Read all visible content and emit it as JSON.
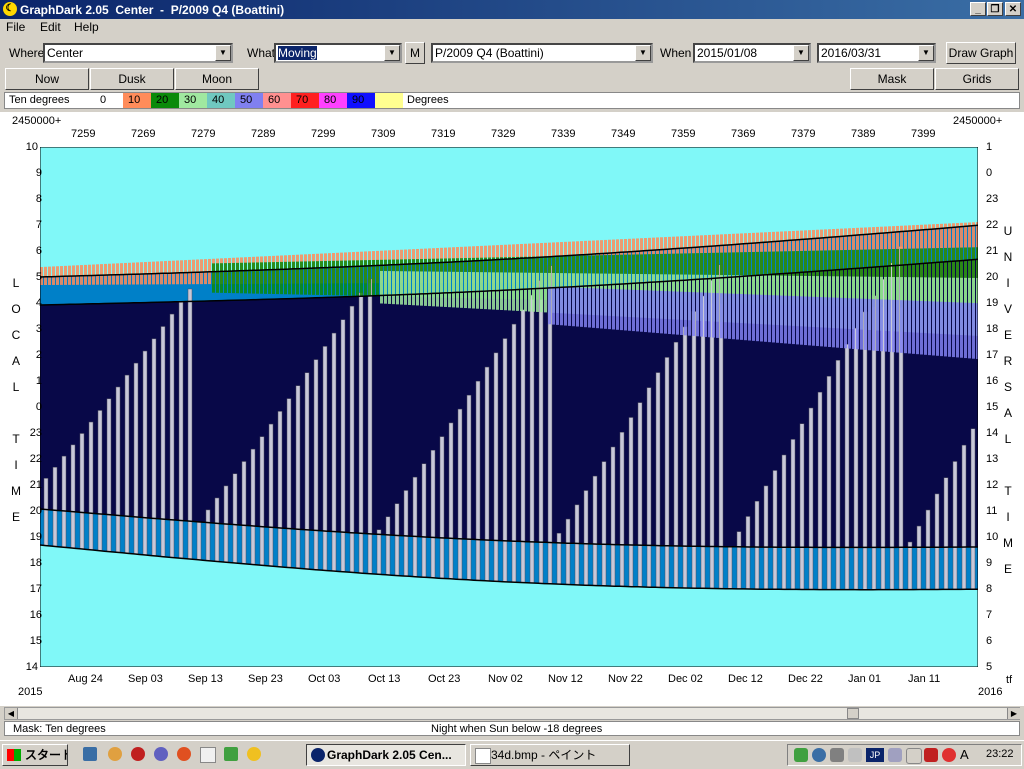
{
  "window": {
    "title": "GraphDark 2.05  Center  -  P/2009 Q4 (Boattini)"
  },
  "menu": [
    "File",
    "Edit",
    "Help"
  ],
  "toolbar": {
    "where_label": "Where",
    "where_value": "Center",
    "what_label": "What",
    "what_value": "Moving",
    "m_button": "M",
    "object_value": "P/2009 Q4 (Boattini)",
    "when_label": "When",
    "start_date": "2015/01/08",
    "end_date": "2016/03/31",
    "draw_button": "Draw Graph"
  },
  "buttons": {
    "now": "Now",
    "dusk": "Dusk",
    "moon": "Moon",
    "mask": "Mask",
    "grids": "Grids"
  },
  "legend": {
    "title": "Ten degrees",
    "items": [
      {
        "label": "0",
        "color": "#ffffff"
      },
      {
        "label": "10",
        "color": "#ff8c5a"
      },
      {
        "label": "20",
        "color": "#0a8a0a"
      },
      {
        "label": "30",
        "color": "#a0e8a0"
      },
      {
        "label": "40",
        "color": "#70c8c0"
      },
      {
        "label": "50",
        "color": "#8080f0"
      },
      {
        "label": "60",
        "color": "#ff9090"
      },
      {
        "label": "70",
        "color": "#ff2020"
      },
      {
        "label": "80",
        "color": "#ff40ff"
      },
      {
        "label": "90",
        "color": "#1010ff"
      },
      {
        "label": "",
        "color": "#ffff90"
      }
    ],
    "unit": "Degrees"
  },
  "plot": {
    "jd_prefix_left": "2450000+",
    "jd_prefix_right": "2450000+",
    "jd_ticks": [
      "7259",
      "7269",
      "7279",
      "7289",
      "7299",
      "7309",
      "7319",
      "7329",
      "7339",
      "7349",
      "7359",
      "7369",
      "7379",
      "7389",
      "7399"
    ],
    "date_ticks": [
      "Aug 24",
      "Sep 03",
      "Sep 13",
      "Sep 23",
      "Oct 03",
      "Oct 13",
      "Oct 23",
      "Nov 02",
      "Nov 12",
      "Nov 22",
      "Dec 02",
      "Dec 12",
      "Dec 22",
      "Jan 01",
      "Jan 11"
    ],
    "year_left": "2015",
    "year_right": "2016",
    "corner_right": "tf",
    "left_hours": [
      "10",
      "9",
      "8",
      "7",
      "6",
      "5",
      "4",
      "3",
      "2",
      "1",
      "0",
      "23",
      "22",
      "21",
      "20",
      "19",
      "18",
      "17",
      "16",
      "15",
      "14"
    ],
    "right_hours": [
      "1",
      "0",
      "23",
      "22",
      "21",
      "20",
      "19",
      "18",
      "17",
      "16",
      "15",
      "14",
      "13",
      "12",
      "11",
      "10",
      "9",
      "8",
      "7",
      "6",
      "5"
    ],
    "left_axis_letters": [
      "L",
      "O",
      "C",
      "A",
      "L",
      "",
      "T",
      "I",
      "M",
      "E"
    ],
    "right_axis_letters": [
      "U",
      "N",
      "I",
      "V",
      "E",
      "R",
      "S",
      "A",
      "L",
      "",
      "T",
      "I",
      "M",
      "E"
    ]
  },
  "colors": {
    "sky_day": "#80f8f8",
    "night": "#080848",
    "twilight": "#0080c8",
    "moon_bars": "#c8c8d8"
  },
  "status": {
    "left": "Mask:  Ten degrees",
    "center": "Night when Sun below -18 degrees"
  },
  "taskbar": {
    "start": "スタート",
    "tasks": [
      "GraphDark  2.05   Cen...",
      "34d.bmp - ペイント"
    ],
    "clock": "23:22",
    "tray_ime": "JP",
    "tray_a": "A"
  }
}
